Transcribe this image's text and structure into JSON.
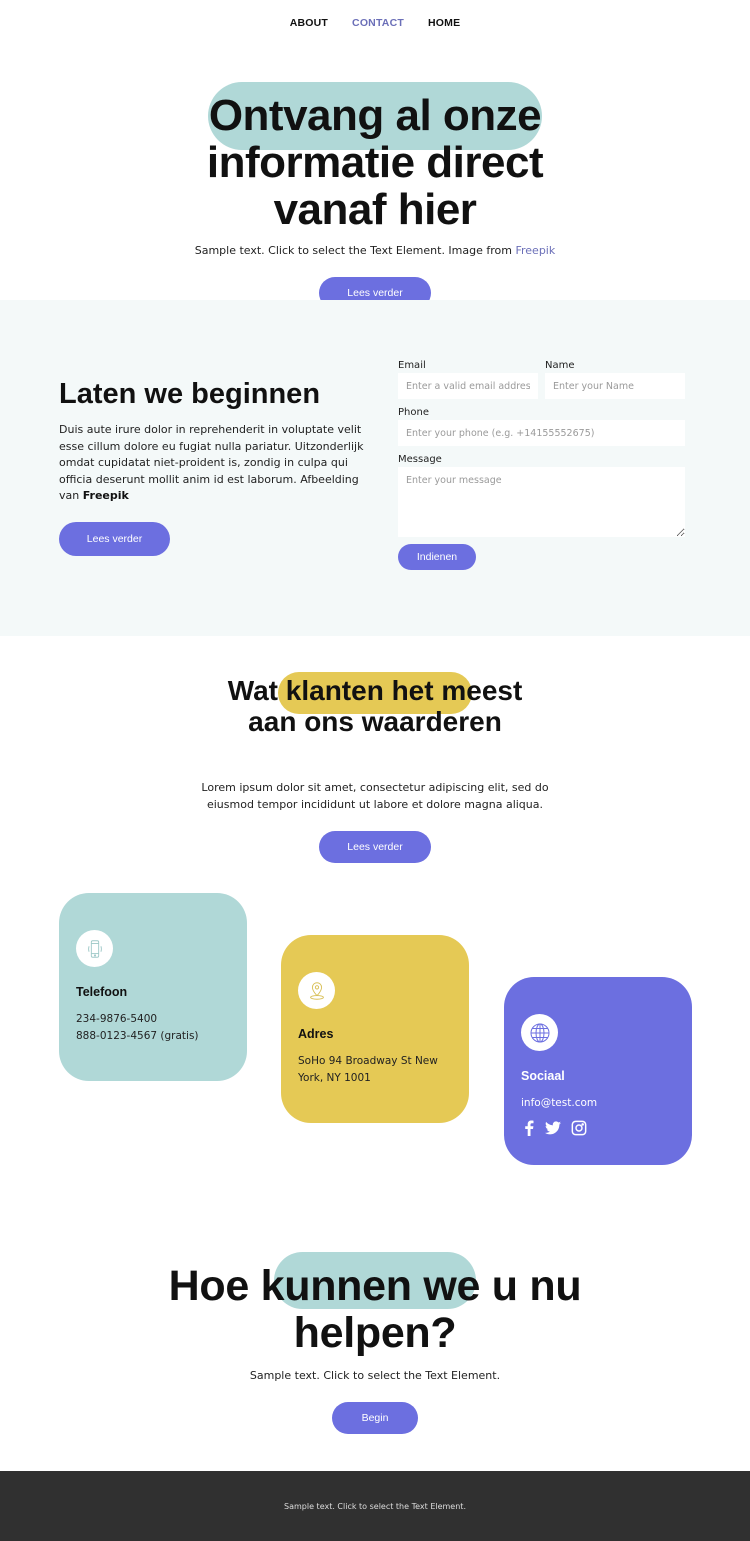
{
  "nav": {
    "items": [
      {
        "label": "ABOUT",
        "active": false
      },
      {
        "label": "CONTACT",
        "active": true
      },
      {
        "label": "HOME",
        "active": false
      }
    ]
  },
  "hero": {
    "title": "Ontvang al onze informatie direct vanaf hier",
    "subtitle": "Sample text. Click to select the Text Element. Image from ",
    "subtitle_link": "Freepik",
    "button": "Lees verder"
  },
  "contact_section": {
    "title": "Laten we beginnen",
    "text": "Duis aute irure dolor in reprehenderit in voluptate velit esse cillum dolore eu fugiat nulla pariatur. Uitzonderlijk omdat cupidatat niet-proident is, zondig in culpa qui officia deserunt mollit anim id est laborum. Afbeelding van ",
    "text_bold": "Freepik",
    "button": "Lees verder",
    "form": {
      "email_label": "Email",
      "email_placeholder": "Enter a valid email address",
      "name_label": "Name",
      "name_placeholder": "Enter your Name",
      "phone_label": "Phone",
      "phone_placeholder": "Enter your phone (e.g. +14155552675)",
      "message_label": "Message",
      "message_placeholder": "Enter your message",
      "submit": "Indienen"
    }
  },
  "testimonials": {
    "title": "Wat klanten het meest aan ons waarderen",
    "text": "Lorem ipsum dolor sit amet, consectetur adipiscing elit, sed do eiusmod tempor incididunt ut labore et dolore magna aliqua.",
    "button": "Lees verder"
  },
  "cards": [
    {
      "icon": "phone-icon",
      "title": "Telefoon",
      "lines": [
        "234-9876-5400",
        "888-0123-4567 (gratis)"
      ],
      "color": "#b0d8d7"
    },
    {
      "icon": "location-pin-icon",
      "title": "Adres",
      "lines": [
        "SoHo 94 Broadway St New York, NY 1001"
      ],
      "color": "#e5c955"
    },
    {
      "icon": "globe-icon",
      "title": "Sociaal",
      "lines": [
        "info@test.com"
      ],
      "color": "#6c6fe0",
      "socials": [
        "facebook-icon",
        "twitter-icon",
        "instagram-icon"
      ]
    }
  ],
  "help": {
    "title": "Hoe kunnen we u nu helpen?",
    "subtitle": "Sample text. Click to select the Text Element.",
    "button": "Begin"
  },
  "footer": {
    "text": "Sample text. Click to select the Text Element."
  },
  "colors": {
    "accent": "#6c6fe0",
    "teal": "#b0d8d7",
    "yellow": "#e5c955",
    "footer_bg": "#303030",
    "section_bg": "#f4f9f9",
    "nav_active": "#6b6fb8"
  }
}
